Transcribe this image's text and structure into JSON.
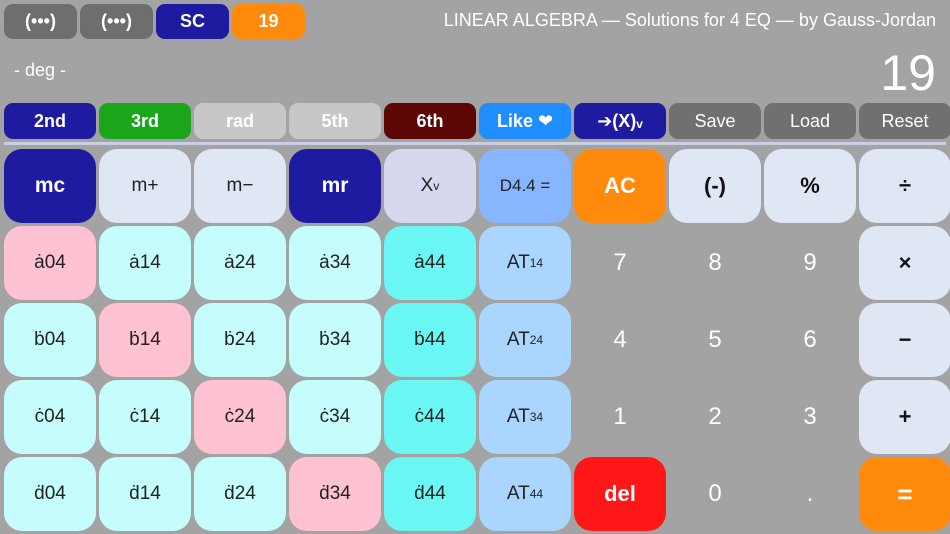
{
  "top_buttons": [
    {
      "label": "(•••)",
      "color": "#6e6e6e"
    },
    {
      "label": "(•••)",
      "color": "#6e6e6e"
    },
    {
      "label": "SC",
      "color": "#1f1ba0"
    },
    {
      "label": "19",
      "color": "#ff8a0c"
    }
  ],
  "title": "LINEAR ALGEBRA — Solutions for 4 EQ —  by Gauss-Jordan",
  "mode_label": "- deg -",
  "display_value": "19",
  "function_buttons": [
    {
      "label": "2nd",
      "color": "#1f1ba0"
    },
    {
      "label": "3rd",
      "color": "#1ba51b"
    },
    {
      "label": "rad",
      "color": "#c7c7c7"
    },
    {
      "label": "5th",
      "color": "#c7c7c7"
    },
    {
      "label": "6th",
      "color": "#5c0606"
    },
    {
      "label": "Like ❤",
      "color": "#1d8dff"
    },
    {
      "label": "➔(X)ᵥ",
      "color": "#1f1ba0"
    },
    {
      "label": "Save",
      "color": "#707070"
    },
    {
      "label": "Load",
      "color": "#707070"
    },
    {
      "label": "Reset",
      "color": "#707070"
    }
  ],
  "memory_row": {
    "mc": "mc",
    "m_plus": "m+",
    "m_minus": "m−",
    "mr": "mr",
    "xv": "X",
    "xv_sub": "v",
    "d44": "D4.4 =",
    "ac": "AC",
    "neg": "(-)",
    "percent": "%",
    "divide": "÷"
  },
  "matrix_rows": [
    [
      "ȧ04",
      "ȧ14",
      "ȧ24",
      "ȧ34",
      "ȧ44"
    ],
    [
      "ḃ04",
      "ḃ14",
      "ḃ24",
      "ḃ34",
      "ḃ44"
    ],
    [
      "ċ04",
      "ċ14",
      "ċ24",
      "ċ34",
      "ċ44"
    ],
    [
      "ḋ04",
      "ḋ14",
      "ḋ24",
      "ḋ34",
      "ḋ44"
    ]
  ],
  "at_buttons": [
    {
      "label": "AT",
      "sub": "14"
    },
    {
      "label": "AT",
      "sub": "24"
    },
    {
      "label": "AT",
      "sub": "34"
    },
    {
      "label": "AT",
      "sub": "44"
    }
  ],
  "keypad": {
    "seven": "7",
    "eight": "8",
    "nine": "9",
    "multiply": "×",
    "four": "4",
    "five": "5",
    "six": "6",
    "minus": "−",
    "one": "1",
    "two": "2",
    "three": "3",
    "plus": "+",
    "del": "del",
    "zero": "0",
    "dot": ".",
    "equals": "="
  },
  "colors": {
    "background": "#a3a3a3",
    "key_light": "#dfe6f4",
    "key_navy": "#1f1ba0",
    "key_lavender": "#d6d8f0",
    "key_blue": "#87b6ff",
    "key_orange": "#ff8a0c",
    "key_red": "#ff1616",
    "key_pink": "#ffc2d2",
    "key_cyan": "#c4fdfc",
    "key_aqua": "#6af7f3",
    "key_at": "#a9d5ff"
  }
}
